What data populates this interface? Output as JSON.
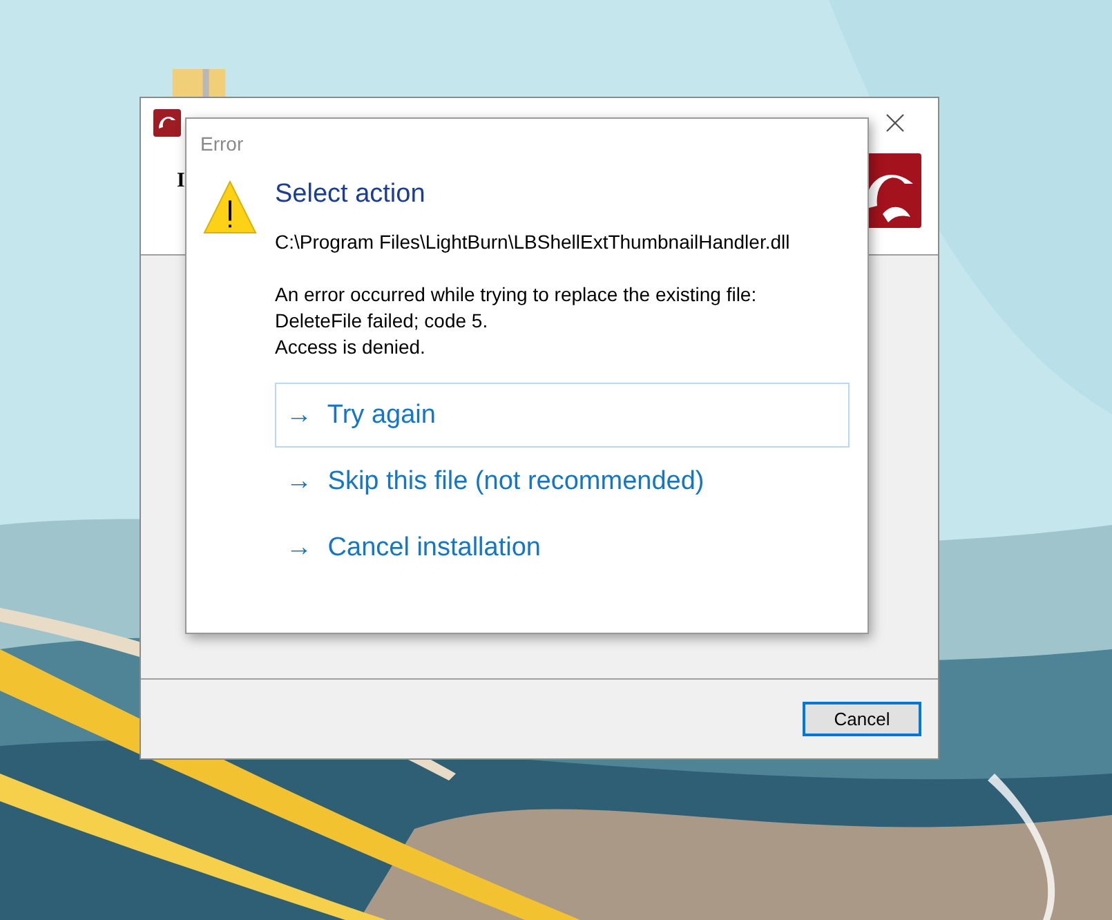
{
  "installer_window": {
    "header_text": "I",
    "cancel_button": "Cancel"
  },
  "error_dialog": {
    "title": "Error",
    "heading": "Select action",
    "file_path": "C:\\Program Files\\LightBurn\\LBShellExtThumbnailHandler.dll",
    "message_lines": [
      "An error occurred while trying to replace the existing file:",
      "DeleteFile failed; code 5.",
      "Access is denied."
    ],
    "actions": [
      {
        "arrow": "→",
        "label": "Try again",
        "selected": true
      },
      {
        "arrow": "→",
        "label": "Skip this file (not recommended)",
        "selected": false
      },
      {
        "arrow": "→",
        "label": "Cancel installation",
        "selected": false
      }
    ]
  }
}
